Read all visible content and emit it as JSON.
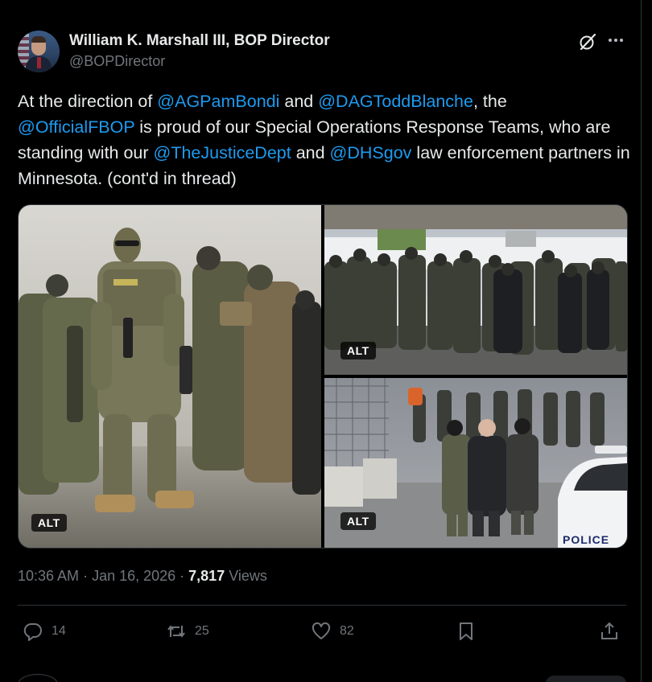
{
  "author": {
    "display_name": "William K. Marshall III, BOP Director",
    "handle": "@BOPDirector"
  },
  "icons": {
    "grok": "grok-icon",
    "more": "more-horizontal-icon",
    "reply": "reply-icon",
    "repost": "repost-icon",
    "like": "heart-icon",
    "bookmark": "bookmark-icon",
    "share": "share-icon"
  },
  "tweet": {
    "seg1": "At the direction of ",
    "mention1": "@AGPamBondi",
    "seg2": " and ",
    "mention2": "@DAGToddBlanche",
    "seg3": ", the ",
    "mention3": "@OfficialFBOP",
    "seg4": " is proud of our Special Operations Response Teams, who are standing with our ",
    "mention4": "@TheJusticeDept",
    "seg5": " and ",
    "mention5": "@DHSgov",
    "seg6": " law enforcement partners in Minnesota. (cont'd in thread)"
  },
  "media": {
    "alt_label": "ALT",
    "police_label": "POLICE"
  },
  "meta": {
    "time": "10:36 AM",
    "dot1": " · ",
    "date": "Jan 16, 2026",
    "dot2": " · ",
    "views_count": "7,817",
    "views_label": " Views"
  },
  "actions": {
    "replies": "14",
    "reposts": "25",
    "likes": "82"
  },
  "colors": {
    "background": "#000000",
    "text": "#e7e9ea",
    "secondary": "#71767b",
    "link": "#1d9bf0",
    "border": "#2f3336"
  }
}
